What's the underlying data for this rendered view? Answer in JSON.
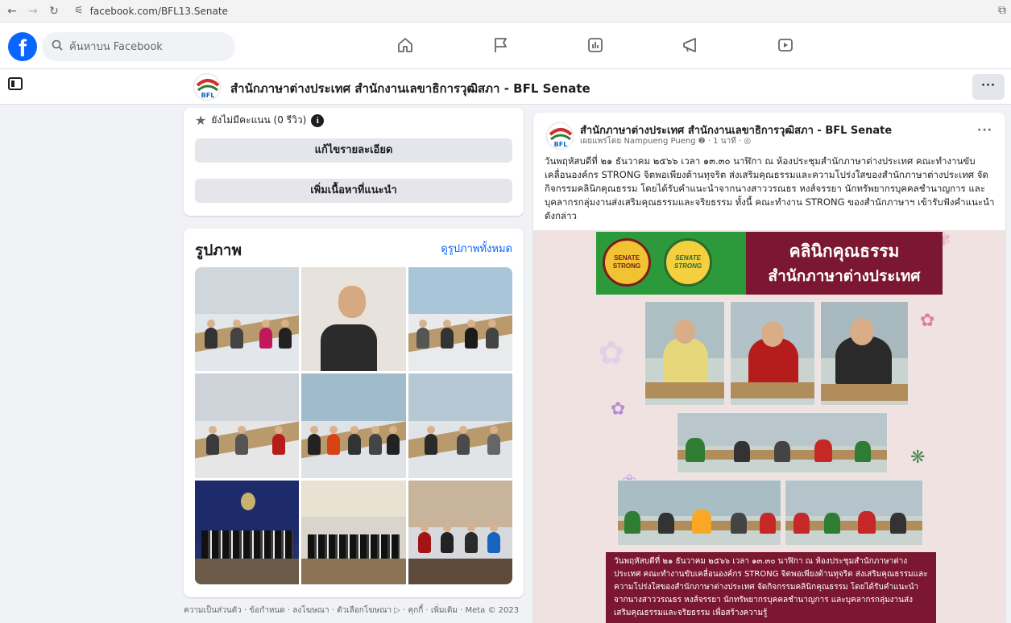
{
  "browser": {
    "url": "facebook.com/BFL13.Senate"
  },
  "header": {
    "logo": "f",
    "search_placeholder": "ค้นหาบน Facebook"
  },
  "page": {
    "name": "สำนักภาษาต่างประเทศ สำนักงานเลขาธิการวุฒิสภา - BFL Senate",
    "more": "···"
  },
  "intro": {
    "rating": "ยังไม่มีคะแนน (0 รีวิว)",
    "info": "i",
    "edit_details": "แก้ไขรายละเอียด",
    "add_featured": "เพิ่มเนื้อหาที่แนะนำ"
  },
  "photos": {
    "title": "รูปภาพ",
    "see_all": "ดูรูปภาพทั้งหมด"
  },
  "footer": {
    "text": "ความเป็นส่วนตัว · ข้อกำหนด · ลงโฆษณา · ตัวเลือกโฆษณา ▷ · คุกกี้ · เพิ่มเติม · Meta © 2023"
  },
  "post": {
    "author": "สำนักภาษาต่างประเทศ สำนักงานเลขาธิการวุฒิสภา - BFL Senate",
    "meta": "เผยแพร่โดย Nampueng Pueng ❷ · 1 นาที · ◎",
    "more": "···",
    "body": "วันพฤหัสบดีที่ ๒๑ ธันวาคม ๒๕๖๖ เวลา ๑๓.๓๐ นาฬิกา ณ ห้องประชุมสำนักภาษาต่างประเทศ คณะทำงานขับเคลื่อนองค์กร STRONG จิตพอเพียงต้านทุจริต ส่งเสริมคุณธรรมและความโปร่งใสของสำนักภาษาต่างประเทศ จัดกิจกรรมคลินิกคุณธรรม โดยได้รับคำแนะนำจากนางสาววรณธร หงส์จรรยา นักทรัพยากรบุคคลชำนาญการ และบุคลากรกลุ่มงานส่งเสริมคุณธรรมและจริยธรรม ทั้งนี้ คณะทำงาน STRONG ของสำนักภาษาฯ เข้ารับฟังคำแนะนำดังกล่าว",
    "image": {
      "logo1": "SENATE STRONG",
      "logo2": "SENATE STRONG",
      "banner_line1": "คลินิกคุณธรรม",
      "banner_line2": "สำนักภาษาต่างประเทศ",
      "caption": "วันพฤหัสบดีที่ ๒๑ ธันวาคม ๒๕๖๖ เวลา ๑๓.๓๐ นาฬิกา ณ ห้องประชุมสำนักภาษาต่างประเทศ คณะทำงานขับเคลื่อนองค์กร STRONG จิตพอเพียงต้านทุจริต ส่งเสริมคุณธรรมและความโปร่งใสของสำนักภาษาต่างประเทศ จัดกิจกรรมคลินิกคุณธรรม โดยได้รับคำแนะนำจากนางสาววรณธร หงส์จรรยา นักทรัพยากรบุคคลชำนาญการ และบุคลากรกลุ่มงานส่งเสริมคุณธรรมและจริยธรรม เพื่อสร้างความรู้"
    }
  },
  "colors": {
    "fb_blue": "#0866ff",
    "banner_maroon": "#7b1730",
    "banner_green": "#2c9a3b"
  }
}
